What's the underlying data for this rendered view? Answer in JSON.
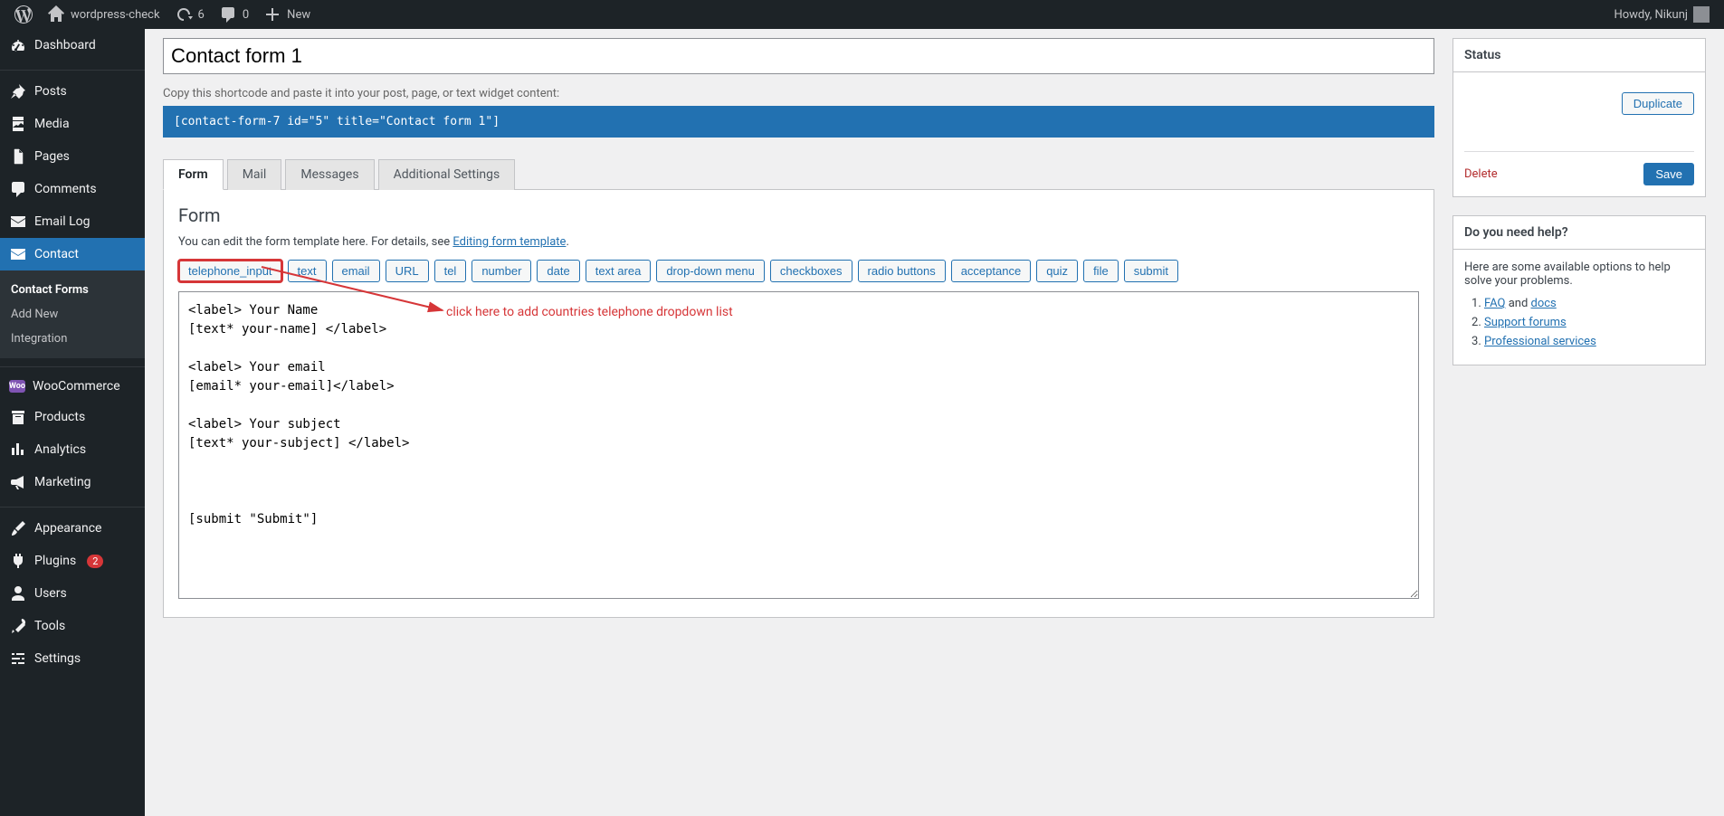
{
  "adminbar": {
    "site_name": "wordpress-check",
    "updates_count": "6",
    "comments_count": "0",
    "new_label": "New",
    "howdy": "Howdy, Nikunj"
  },
  "sidebar": {
    "items": [
      {
        "label": "Dashboard",
        "icon": "dashboard"
      },
      {
        "label": "Posts",
        "icon": "posts"
      },
      {
        "label": "Media",
        "icon": "media"
      },
      {
        "label": "Pages",
        "icon": "pages"
      },
      {
        "label": "Comments",
        "icon": "comments"
      },
      {
        "label": "Email Log",
        "icon": "email"
      },
      {
        "label": "Contact",
        "icon": "email",
        "current": true
      },
      {
        "label": "WooCommerce",
        "icon": "woo"
      },
      {
        "label": "Products",
        "icon": "products"
      },
      {
        "label": "Analytics",
        "icon": "analytics"
      },
      {
        "label": "Marketing",
        "icon": "marketing"
      },
      {
        "label": "Appearance",
        "icon": "appearance"
      },
      {
        "label": "Plugins",
        "icon": "plugins",
        "badge": "2"
      },
      {
        "label": "Users",
        "icon": "users"
      },
      {
        "label": "Tools",
        "icon": "tools"
      },
      {
        "label": "Settings",
        "icon": "settings"
      }
    ],
    "submenu": {
      "items": [
        {
          "label": "Contact Forms",
          "current": true
        },
        {
          "label": "Add New"
        },
        {
          "label": "Integration"
        }
      ]
    }
  },
  "main": {
    "title_value": "Contact form 1",
    "shortcode_hint": "Copy this shortcode and paste it into your post, page, or text widget content:",
    "shortcode": "[contact-form-7 id=\"5\" title=\"Contact form 1\"]",
    "tabs": [
      {
        "label": "Form",
        "active": true
      },
      {
        "label": "Mail"
      },
      {
        "label": "Messages"
      },
      {
        "label": "Additional Settings"
      }
    ],
    "panel": {
      "heading": "Form",
      "desc_prefix": "You can edit the form template here. For details, see ",
      "desc_link": "Editing form template",
      "desc_suffix": ".",
      "tags": [
        "telephone_input",
        "text",
        "email",
        "URL",
        "tel",
        "number",
        "date",
        "text area",
        "drop-down menu",
        "checkboxes",
        "radio buttons",
        "acceptance",
        "quiz",
        "file",
        "submit"
      ],
      "textarea_value": "<label> Your Name\n[text* your-name] </label>\n\n<label> Your email\n[email* your-email]</label>\n\n<label> Your subject\n[text* your-subject] </label>\n\n\n\n[submit \"Submit\"]"
    },
    "annotation_text": "click here to add countries telephone dropdown list"
  },
  "side": {
    "status": {
      "title": "Status",
      "duplicate": "Duplicate",
      "delete": "Delete",
      "save": "Save"
    },
    "help": {
      "title": "Do you need help?",
      "intro": "Here are some available options to help solve your problems.",
      "links": [
        {
          "prefix": "",
          "link": "FAQ",
          "mid": " and ",
          "link2": "docs"
        },
        {
          "link": "Support forums"
        },
        {
          "link": "Professional services"
        }
      ]
    }
  }
}
